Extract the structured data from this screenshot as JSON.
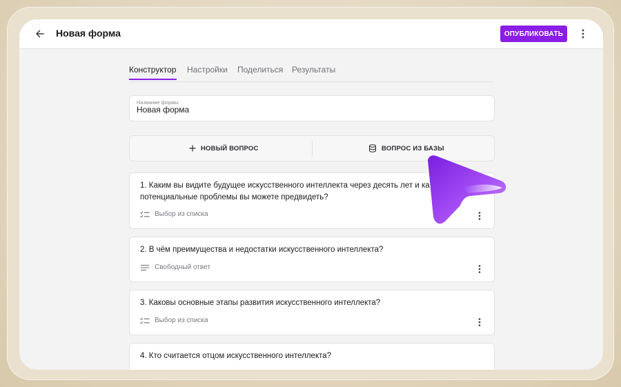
{
  "header": {
    "title": "Новая форма",
    "publish_label": "ОПУБЛИКОВАТЬ"
  },
  "tabs": [
    {
      "label": "Конструктор",
      "active": true
    },
    {
      "label": "Настройки",
      "active": false
    },
    {
      "label": "Поделиться",
      "active": false
    },
    {
      "label": "Результаты",
      "active": false
    }
  ],
  "form": {
    "name_label": "Название формы",
    "name_value": "Новая форма"
  },
  "actions": {
    "new_question": "НОВЫЙ ВОПРОС",
    "from_base": "ВОПРОС ИЗ БАЗЫ"
  },
  "questions": [
    {
      "line1": "1. Каким вы видите будущее искусственного интеллекта через десять лет и ка",
      "line2": "потенциальные проблемы вы можете предвидеть?",
      "type": "Выбор из списка",
      "type_icon": "checklist-icon"
    },
    {
      "line1": "2. В чём преимущества и недостатки искусственного интеллекта?",
      "type": "Свободный ответ",
      "type_icon": "text-lines-icon"
    },
    {
      "line1": "3. Каковы основные этапы развития искусственного интеллекта?",
      "type": "Выбор из списка",
      "type_icon": "checklist-icon"
    },
    {
      "line1": "4. Кто считается отцом искусственного интеллекта?"
    }
  ],
  "colors": {
    "accent": "#8b1ee6",
    "cursor": "#9b34f0"
  }
}
